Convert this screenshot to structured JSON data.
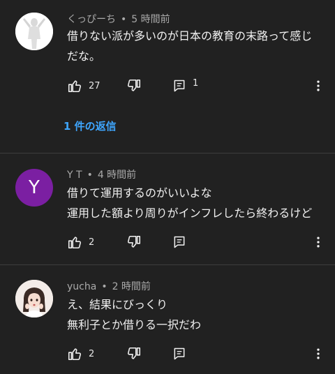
{
  "comments": [
    {
      "author": "くっぴーち",
      "time": "5 時間前",
      "lines": [
        "借りない派が多いのが日本の教育の末路って感じ",
        "だな。"
      ],
      "likes": "27",
      "replies": "1",
      "replies_link": "1 件の返信",
      "avatar": {
        "type": "figure",
        "bg": "#ffffff"
      }
    },
    {
      "author": "Y T",
      "time": "4 時間前",
      "lines": [
        "借りて運用するのがいいよな",
        "運用した額より周りがインフレしたら終わるけど"
      ],
      "likes": "2",
      "avatar": {
        "type": "letter",
        "letter": "Y",
        "bg": "#7b1fa2"
      }
    },
    {
      "author": "yucha",
      "time": "2 時間前",
      "lines": [
        "え、結果にびっくり",
        "無利子とか借りる一択だわ"
      ],
      "likes": "2",
      "avatar": {
        "type": "photo",
        "bg": "#f3ece8"
      }
    }
  ],
  "icons": {
    "like": "thumbs-up-icon",
    "dislike": "thumbs-down-icon",
    "reply": "comment-reply-icon",
    "more": "more-vert-icon"
  },
  "colors": {
    "background": "#212121",
    "link": "#3ea6ff",
    "meta_text": "#aaaaaa",
    "divider": "#3d3d3d"
  }
}
